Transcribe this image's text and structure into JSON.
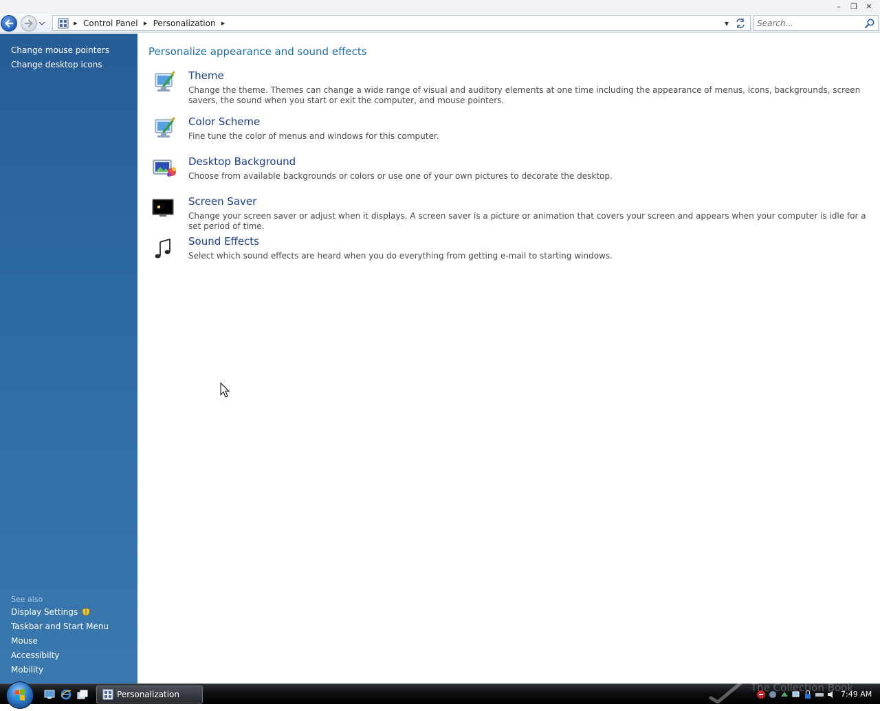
{
  "window": {
    "minimize": "–",
    "maximize": "❐",
    "close": "✕"
  },
  "address_bar": {
    "crumbs": [
      "Control Panel",
      "Personalization"
    ]
  },
  "search": {
    "placeholder": "Search..."
  },
  "sidebar": {
    "tasks": [
      "Change mouse pointers",
      "Change desktop icons"
    ],
    "see_also_heading": "See also",
    "see_also": [
      "Display Settings",
      "Taskbar and Start Menu",
      "Mouse",
      "Accessibilty",
      "Mobility"
    ]
  },
  "main": {
    "title": "Personalize appearance and sound effects",
    "items": [
      {
        "title": "Theme",
        "desc": "Change the theme. Themes can change a wide range of visual and auditory elements at one time including the appearance of menus, icons, backgrounds, screen savers, the sound when you start or exit the computer, and mouse pointers.",
        "icon": "theme-icon"
      },
      {
        "title": "Color Scheme",
        "desc": "Fine tune the color of menus and windows for this computer.",
        "icon": "color-scheme-icon"
      },
      {
        "title": "Desktop Background",
        "desc": "Choose from available backgrounds or colors or use one of your own pictures to decorate the desktop.",
        "icon": "desktop-background-icon"
      },
      {
        "title": "Screen Saver",
        "desc": "Change your screen saver or adjust when it displays. A screen saver is a picture or animation that covers your screen and appears when your computer is idle for a set period of time.",
        "icon": "screen-saver-icon"
      },
      {
        "title": "Sound Effects",
        "desc": "Select which sound effects are heard when you do everything from getting e-mail to starting windows.",
        "icon": "music-note-icon"
      }
    ]
  },
  "taskbar": {
    "active_window": "Personalization",
    "watermark": "The Collection Book",
    "clock": "7:49 AM"
  },
  "colors": {
    "sidebar": "#2e6ba5",
    "link": "#1c3d8f",
    "page_title": "#1b6ea6"
  }
}
